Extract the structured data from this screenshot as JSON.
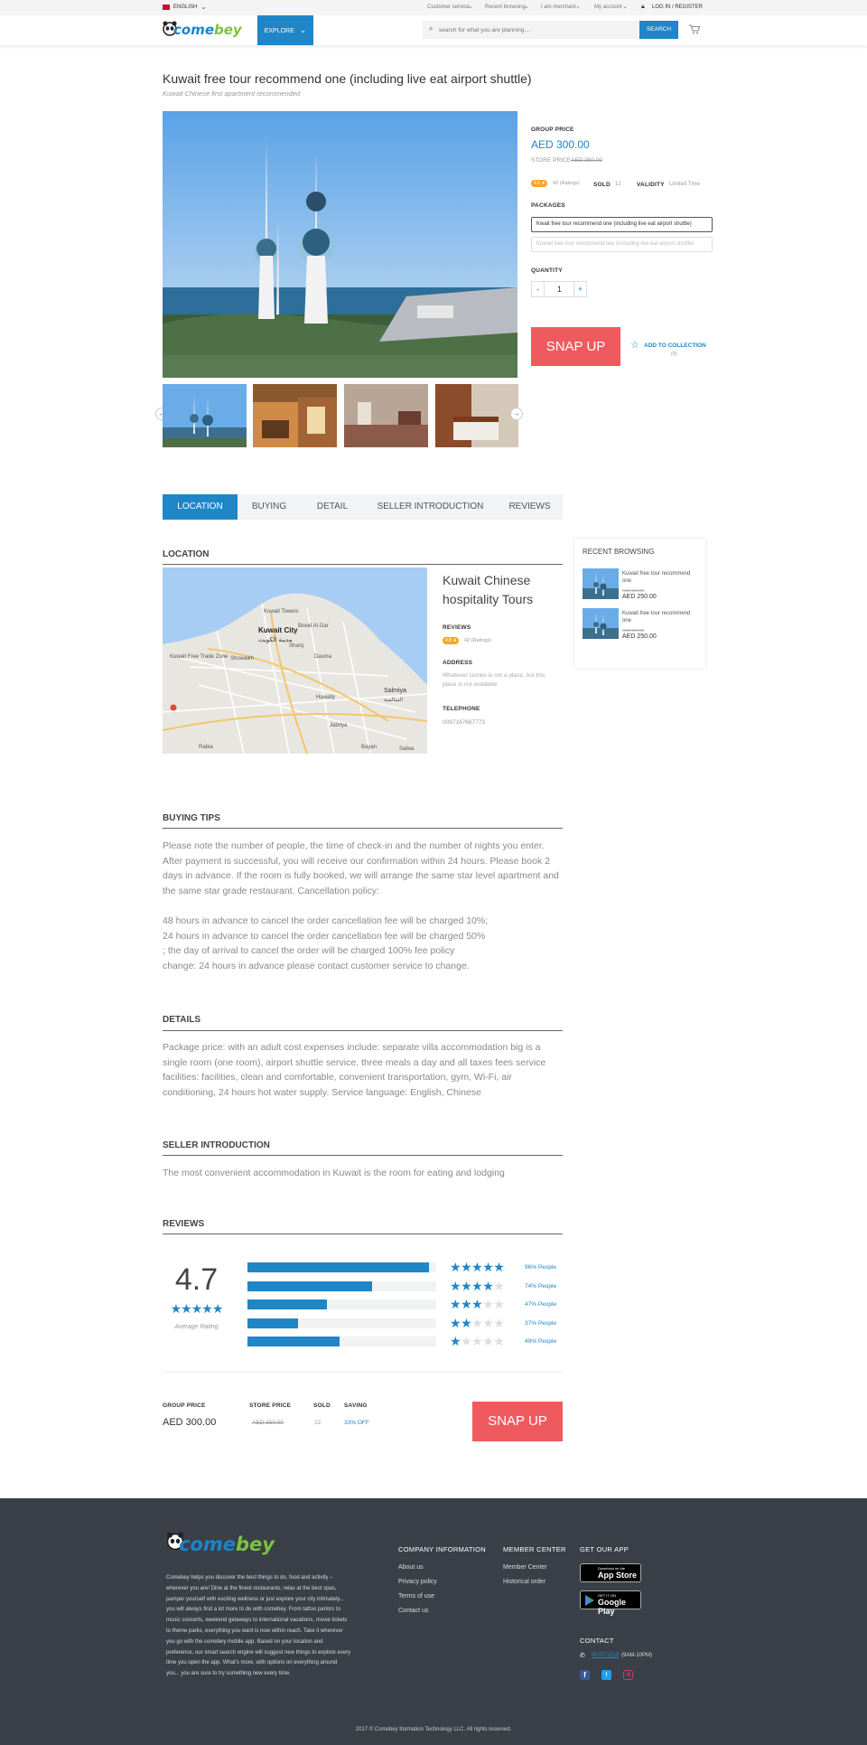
{
  "topbar": {
    "language": "ENGLISH",
    "links": [
      "Customer service",
      "Recent browsing",
      "I am merchant",
      "My account"
    ],
    "login": "LOG IN / REGISTER"
  },
  "header": {
    "logo_part1": "come",
    "logo_part2": "bey",
    "explore": "EXPLORE",
    "search_placeholder": "search for what you are planning....",
    "search_button": "SEARCH"
  },
  "product": {
    "title": "Kuwait free tour recommend one (including live eat airport shuttle)",
    "subtitle": "Kuwait Chinese first apartment recommended",
    "group_price_label": "GROUP PRICE",
    "group_price": "AED 300.00",
    "store_price_label": "STORE PRICE",
    "store_price": "AED 350.00",
    "rating_badge": "4.8",
    "ratings": "42 (Ratings)",
    "sold_label": "SOLD",
    "sold": "12",
    "validity_label": "VALIDITY",
    "validity": "Limited Time",
    "packages_label": "PACKAGES",
    "packages": [
      "Kwait free tour recommend one (including live eat airport shuttle)",
      "Kuwait free tour recommend two (including live eat airport shuttle)"
    ],
    "quantity_label": "QUANTITY",
    "quantity_minus": "-",
    "quantity": "1",
    "quantity_plus": "+",
    "snap_up": "SNAP UP",
    "add_collection": "ADD TO COLLECTION",
    "collection_count": "(0)"
  },
  "tabs": [
    "LOCATION",
    "BUYING",
    "DETAIL",
    "SELLER INTRODUCTION",
    "REVIEWS"
  ],
  "location": {
    "heading": "LOCATION",
    "place_name": "Kuwait Chinese hospitality Tours",
    "reviews_label": "REVIEWS",
    "rating_badge": "4.8",
    "ratings": "42 (Ratings)",
    "address_label": "ADDRESS",
    "address": "Whatever comes is not a place, but this place is not available",
    "telephone_label": "TELEPHONE",
    "telephone": "0097167667773",
    "map_labels": [
      "Kuwait Towers",
      "Kuwait City",
      "مدينة الكويت",
      "Shuwaikh",
      "Salmiya",
      "السالمية",
      "Hawally",
      "Jabriya",
      "Bayan",
      "Salwa",
      "Rabia",
      "Kuwait Free Trade Zone",
      "Sharq",
      "Dasma",
      "Bneid Al Gar"
    ]
  },
  "recent": {
    "heading": "RECENT BROWSING",
    "items": [
      {
        "title": "Kuwait free tour recommend one",
        "old_price": "AED 350.00",
        "price": "AED 250.00"
      },
      {
        "title": "Kuwait free tour recommend one",
        "old_price": "AED 350.00",
        "price": "AED 250.00"
      }
    ]
  },
  "buying": {
    "heading": "BUYING TIPS",
    "paragraph1": "Please note the number of people, the time of check-in and the number of nights you enter. After payment is successful, you will receive our confirmation within 24 hours. Please book 2 days in advance. If the room is fully booked, we will arrange the same star level apartment and the same star grade restaurant. Cancellation policy:",
    "lines": [
      "48 hours in advance to cancel the order cancellation fee will be charged 10%;",
      "24 hours in advance to cancel the order cancellation fee will be charged 50%",
      "; the day of arrival to cancel the order will be charged 100% fee policy",
      "change: 24 hours in advance please contact customer service to change."
    ]
  },
  "details": {
    "heading": "DETAILS",
    "text": "Package price: with an adult cost expenses include: separate villa accommodation big is a single room (one room), airport shuttle service, three meals a day and all taxes fees service facilities: facilities, clean and comfortable, convenient transportation, gym, Wi-Fi, air conditioning, 24 hours hot water supply. Service language: English, Chinese"
  },
  "seller": {
    "heading": "SELLER INTRODUCTION",
    "text": "The most convenient accommodation in Kuwait is the room for eating and lodging"
  },
  "reviews": {
    "heading": "REVIEWS",
    "average": "4.7",
    "average_label": "Average Rating",
    "rows": [
      {
        "stars": 5,
        "fill": 0.96,
        "label": "96% People"
      },
      {
        "stars": 4,
        "fill": 0.66,
        "label": "74% People"
      },
      {
        "stars": 3,
        "fill": 0.42,
        "label": "47% People"
      },
      {
        "stars": 2,
        "fill": 0.27,
        "label": "37% People"
      },
      {
        "stars": 1,
        "fill": 0.49,
        "label": "49% People"
      }
    ]
  },
  "summary": {
    "group_price_label": "GROUP PRICE",
    "group_price": "AED 300.00",
    "store_price_label": "STORE PRICE",
    "store_price": "AED 350.00",
    "sold_label": "SOLD",
    "sold": "12",
    "saving_label": "SAVING",
    "saving": "33% OFF",
    "snap_up": "SNAP UP"
  },
  "footer": {
    "logo_part1": "come",
    "logo_part2": "bey",
    "about": "Comebey helps you discover the best things to do, food and activity – wherever you are! Dine at the finest restaurants, relax at the best spas, pamper yourself with exciting wellness or just explore your city intimately... you will always find a lot more to do with comebey. From tattoo parlors to music concerts, weekend getaways to international vacations, movie tickets to theme parks, everything you want is now within reach. Take it wherever you go with the comebey mobile app. Based on your location and preference, our smart search engine will suggest new things to explore every time you open the app. What's more, with options on everything around you... you are sure to try something new every time.",
    "company_heading": "COMPANY INFORMATION",
    "company_links": [
      "About us",
      "Privacy policy",
      "Terms of use",
      "Contact us"
    ],
    "member_heading": "MEMBER CENTER",
    "member_links": [
      "Member Center",
      "Historical order"
    ],
    "app_heading": "GET OUR APP",
    "appstore_small": "Download on the",
    "appstore": "App Store",
    "googleplay_small": "GET IT ON",
    "googleplay": "Google Play",
    "contact_heading": "CONTACT",
    "phone": "967871518",
    "hours": "(9AM-10PM)",
    "copyright": "2017 © Comebey Itormation Technology LLC. All rights reserved."
  },
  "colors": {
    "brand_blue": "#1f86c8",
    "brand_green": "#7cc242",
    "snap_red": "#ef5a5e",
    "footer_bg": "#3b4048",
    "badge_orange": "#f5a623"
  }
}
